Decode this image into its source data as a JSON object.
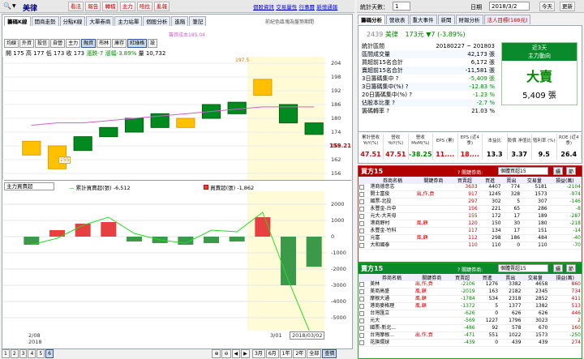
{
  "toolbar": {
    "stock": "美律",
    "buttons": [
      "看法",
      "報告",
      "轉檔",
      "主力",
      "哈拉",
      "亂報"
    ],
    "links": [
      "個股資訊",
      "交易量性",
      "行事曆",
      "新增通報"
    ],
    "days_label": "統計天數：",
    "days_value": "1",
    "date_label": "日期",
    "date_value": "2018/3/2",
    "today_btn": "今天",
    "refresh_btn": "更新"
  },
  "chart_tabs": [
    "籌碼K線",
    "開商走勢",
    "分點K線",
    "大單券商",
    "主力站單",
    "個股分析",
    "進階",
    "筆記"
  ],
  "chart_right_note": "前紀色區塊為盤勢期間",
  "ma_legend": "籌資成本185.04",
  "ind_tabs": [
    "均線",
    "外資",
    "投信",
    "自營",
    "主力",
    "融資",
    "布林",
    "庫存",
    "紅綠格",
    "設"
  ],
  "ohlc": {
    "open_label": "開",
    "open": "175",
    "high_label": "高",
    "high": "177",
    "low_label": "低",
    "low": "173",
    "close_label": "收",
    "close": "173",
    "chg_label": "漲跌",
    "chg": "-7",
    "pct_label": "漲幅",
    "pct": "-3.89%",
    "vol_label": "量",
    "vol": "10,732"
  },
  "price_axis": [
    "204",
    "198",
    "192",
    "186",
    "180",
    "174",
    "168",
    "162",
    "156"
  ],
  "price_tag": "159.21",
  "hi_tag": "197.5",
  "lo_tag": "155",
  "lower_select": "主力買賣超",
  "lower_legend1": "累計買賣超(張)",
  "lower_legend1_val": "-6,512",
  "lower_legend2": "買賣超(張)",
  "lower_legend2_val": "-1,862",
  "lower_axis": [
    "2000",
    "1000",
    "0",
    "-1000",
    "-2000",
    "-3000",
    "-4000",
    "-5000"
  ],
  "date_labels": {
    "start": "2/08",
    "year": "2018",
    "mid": "3/01",
    "end": "2018/03/02"
  },
  "nav_pages": [
    "1",
    "2",
    "3",
    "4",
    "5",
    "6"
  ],
  "nav_ranges": [
    "3月",
    "6月",
    "1年",
    "2年",
    "全部"
  ],
  "nav_end": "查價",
  "right_tabs": [
    "籌碼分析",
    "營收表",
    "重大事件",
    "新聞",
    "財報分析",
    "法人目標(188元)"
  ],
  "ticker": {
    "code": "2439",
    "name": "美律",
    "price": "173元",
    "change": "▼7 (-3.89%)"
  },
  "stats": [
    {
      "label": "統計區間",
      "value": "20180227 ~ 201803",
      "color": "black"
    },
    {
      "label": "區間成交量",
      "value": "42,173 張",
      "color": "black"
    },
    {
      "label": "買超前15名合計",
      "value": "6,172 張",
      "color": "black"
    },
    {
      "label": "賣超前15名合計",
      "value": "-11,581 張",
      "color": "black"
    },
    {
      "label": "3日籌碼集中 ?",
      "value": "-5,409 張",
      "color": "green"
    },
    {
      "label": "3日籌碼集中(%) ?",
      "value": "-12.83 %",
      "color": "green"
    },
    {
      "label": "20日籌碼集中(%) ?",
      "value": "-1.23 %",
      "color": "green"
    },
    {
      "label": "佔股本比重 ?",
      "value": "-2.7 %",
      "color": "green"
    },
    {
      "label": "籌碼轉率 ?",
      "value": "21.03 %",
      "color": "black"
    }
  ],
  "signal": {
    "head1": "近3天",
    "head2": "主力動向",
    "big": "大賣",
    "vol": "5,409 張"
  },
  "fund_headers": [
    "累計營收 YoY(%)",
    "營收 YoY(%)",
    "營收 MoM(%)",
    "EPS (累)",
    "EPS (近4季)",
    "本益比",
    "股價 淨值比",
    "殖利率 (%)",
    "ROE (近4季)"
  ],
  "fund_values": [
    {
      "v": "47.51",
      "c": "red"
    },
    {
      "v": "47.51",
      "c": "red"
    },
    {
      "v": "-38.25",
      "c": "green"
    },
    {
      "v": "11....",
      "c": "red"
    },
    {
      "v": "18....",
      "c": "red"
    },
    {
      "v": "13.3",
      "c": "black"
    },
    {
      "v": "3.37",
      "c": "black"
    },
    {
      "v": "9.5",
      "c": "black"
    },
    {
      "v": "26.4",
      "c": "black"
    }
  ],
  "buy_panel": {
    "title": "買方15",
    "q": "? 關鍵券商:",
    "select": "個體買超15",
    "b1": "續",
    "b2": "節"
  },
  "sell_panel": {
    "title": "賣方15",
    "q": "? 關鍵券商:",
    "select": "個體賣超15",
    "b1": "續",
    "b2": "節"
  },
  "broker_headers": [
    "券商名稱",
    "關鍵券商",
    "買賣超",
    "買進",
    "賣出",
    "交易量",
    "損益(萬)"
  ],
  "buy_rows": [
    [
      "港商德意志",
      "",
      "3633",
      "4407",
      "774",
      "5181",
      "-2104"
    ],
    [
      "開士富俊",
      "出,作,貢",
      "917",
      "1245",
      "328",
      "1573",
      "-974"
    ],
    [
      "國票-北投",
      "",
      "297",
      "302",
      "5",
      "307",
      "-146"
    ],
    [
      "永豐金-台中",
      "",
      "156",
      "221",
      "65",
      "286",
      "-8"
    ],
    [
      "元大-大天母",
      "",
      "155",
      "172",
      "17",
      "189",
      "-287"
    ],
    [
      "港商野村",
      "風,顧",
      "120",
      "150",
      "30",
      "180",
      "-218"
    ],
    [
      "永豐金-竹科",
      "",
      "117",
      "134",
      "17",
      "151",
      "-14"
    ],
    [
      "元富",
      "風,顧",
      "112",
      "298",
      "186",
      "484",
      "-40"
    ],
    [
      "大和國泰",
      "",
      "110",
      "110",
      "0",
      "110",
      "-70"
    ]
  ],
  "sell_rows": [
    [
      "美林",
      "出,作,貢",
      "-2106",
      "1276",
      "3382",
      "4658",
      "860"
    ],
    [
      "美商高盛",
      "風,顧",
      "-2019",
      "163",
      "2182",
      "2345",
      "734"
    ],
    [
      "摩根大通",
      "風,顧",
      "-1784",
      "534",
      "2318",
      "2852",
      "411"
    ],
    [
      "港商麥格理",
      "風,顧",
      "-1372",
      "5",
      "1377",
      "1382",
      "513"
    ],
    [
      "台灣匯立",
      "",
      "-626",
      "0",
      "626",
      "626",
      "446"
    ],
    [
      "元大",
      "",
      "-569",
      "1227",
      "1796",
      "3023",
      "2"
    ],
    [
      "國票-新北...",
      "",
      "-486",
      "92",
      "578",
      "670",
      "160"
    ],
    [
      "台灣摩根...",
      "出,作,貢",
      "-471",
      "551",
      "1022",
      "1573",
      "-250"
    ],
    [
      "花旗環球",
      "",
      "-439",
      "0",
      "439",
      "439",
      "274"
    ]
  ],
  "chart_data": {
    "type": "candlestick",
    "title": "",
    "y_axis": {
      "label": "",
      "ticks": [
        204,
        198,
        192,
        186,
        180,
        174,
        168,
        162,
        156
      ]
    },
    "candles": [
      {
        "o": 170,
        "c": 164,
        "color": "yellow"
      },
      {
        "o": 168,
        "c": 158,
        "color": "yellow"
      },
      {
        "o": 166,
        "c": 172,
        "color": "green"
      },
      {
        "o": 172,
        "c": 176,
        "color": "green"
      },
      {
        "o": 174,
        "c": 180,
        "color": "green"
      },
      {
        "o": 176,
        "c": 182,
        "color": "green"
      },
      {
        "o": 180,
        "c": 176,
        "color": "yellow"
      },
      {
        "o": 180,
        "c": 186,
        "color": "green"
      },
      {
        "o": 187,
        "c": 182,
        "color": "green"
      },
      {
        "o": 190,
        "c": 197,
        "color": "yellow"
      },
      {
        "o": 186,
        "c": 178,
        "color": "green"
      },
      {
        "o": 178,
        "c": 173,
        "color": "green"
      }
    ],
    "ma_line": [
      177,
      178,
      178,
      179,
      180,
      181,
      182,
      183,
      184,
      185,
      185,
      185
    ],
    "lower": {
      "type": "bar+line",
      "bars": [
        -500,
        400,
        800,
        900,
        -300,
        -400,
        -500,
        -400,
        -300,
        1200,
        -3000,
        -1862
      ],
      "cumulative": [
        -500,
        -100,
        700,
        1200,
        200,
        -200,
        -400,
        400,
        300,
        1500,
        -2700,
        -6512
      ]
    }
  }
}
